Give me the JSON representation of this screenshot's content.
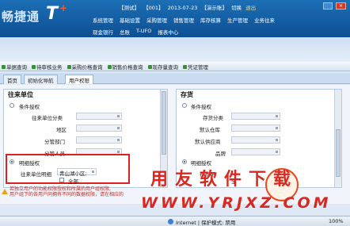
{
  "app": {
    "logo_text": "畅捷通",
    "logo_t": "T",
    "logo_plus": "+"
  },
  "status": {
    "company": "【测试】",
    "account": "【001】",
    "date": "2013-07-23",
    "user": "【演示账】",
    "switch": "切换",
    "exit": "退出"
  },
  "menu_row1": [
    "系统管理",
    "基础设置",
    "采购管理",
    "销售管理",
    "库存核算",
    "生产管理",
    "业务往来"
  ],
  "menu_row2": [
    "现金银行",
    "总账",
    "T-UFO",
    "报表中心"
  ],
  "quick": [
    "单据查询",
    "待审核业务",
    "采购价格查询",
    "销售价格查询",
    "现存量查询",
    "凭证管理"
  ],
  "tabs": [
    "首页",
    "初始化导航",
    "用户权限"
  ],
  "left_panel": {
    "title": "往来单位",
    "option_condition": "条件授权",
    "fields": [
      "往来单位分类",
      "地区",
      "分管部门",
      "分管人员"
    ],
    "option_detail": "明细授权",
    "detail_label": "往来单位明细",
    "detail_value": "青山湖小区;",
    "all_label": "全部"
  },
  "right_panel": {
    "title": "存货",
    "option_condition": "条件授权",
    "fields": [
      "存货分类",
      "默认仓库",
      "默认供应商",
      "品牌"
    ],
    "option_detail": "明细授权",
    "detail_label": "存货明",
    "all_label": "全"
  },
  "note": {
    "line1": "若独立用户的功能权限授权和所属的用户组权限,",
    "line2": "用户组下的各用户同拥有不同的数据权限，请在相应的"
  },
  "watermark": {
    "line1": "用友软件下载",
    "line2": "WWW.YRJXZ.COM"
  },
  "statusbar": {
    "zone": "Internet | 保护模式: 禁用",
    "zoom": "100%"
  },
  "colors": {
    "header": "#1c6fb6",
    "highlight": "#e02020",
    "watermark": "#d9281f"
  }
}
